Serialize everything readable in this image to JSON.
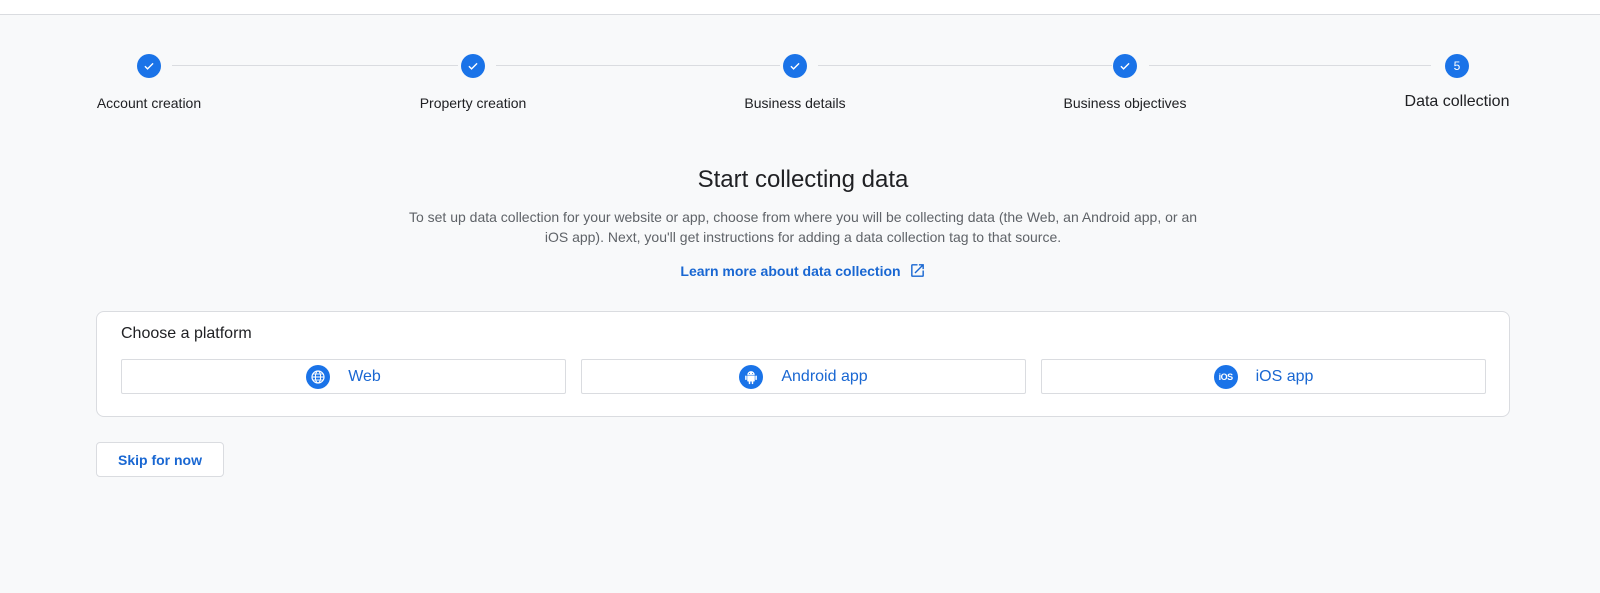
{
  "stepper": {
    "steps": [
      {
        "label": "Account creation",
        "status": "complete",
        "icon": "check-icon"
      },
      {
        "label": "Property creation",
        "status": "complete",
        "icon": "check-icon"
      },
      {
        "label": "Business details",
        "status": "complete",
        "icon": "check-icon"
      },
      {
        "label": "Business objectives",
        "status": "complete",
        "icon": "check-icon"
      },
      {
        "label": "Data collection",
        "status": "active",
        "number": "5"
      }
    ]
  },
  "main": {
    "headline": "Start collecting data",
    "description": "To set up data collection for your website or app, choose from where you will be collecting data (the Web, an Android app, or an iOS app). Next, you'll get instructions for adding a data collection tag to that source.",
    "learn_more": "Learn more about data collection"
  },
  "platform_card": {
    "title": "Choose a platform",
    "options": [
      {
        "label": "Web",
        "icon": "globe-icon"
      },
      {
        "label": "Android app",
        "icon": "android-icon"
      },
      {
        "label": "iOS app",
        "icon": "ios-icon",
        "icon_text": "iOS"
      }
    ]
  },
  "actions": {
    "skip_label": "Skip for now"
  },
  "colors": {
    "accent": "#1a73e8",
    "link": "#1967d2",
    "background": "#f8f9fa",
    "border": "#dadce0"
  }
}
